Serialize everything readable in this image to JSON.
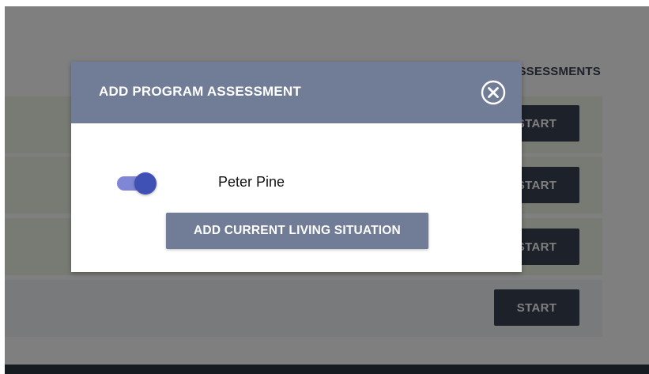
{
  "background": {
    "section_header": "ASSESSMENTS",
    "start_label": "START"
  },
  "modal": {
    "title": "ADD PROGRAM ASSESSMENT",
    "close_icon": "circle-x-icon",
    "toggle_on": true,
    "person_name": "Peter Pine",
    "add_button_label": "ADD CURRENT LIVING SITUATION"
  },
  "colors": {
    "modal_header": "#717c96",
    "toggle_knob": "#3f51b5",
    "toggle_track": "#7f86d6",
    "start_button": "#3b4354",
    "row_green": "#f1f7e6",
    "row_gray": "#f3f4f6"
  }
}
